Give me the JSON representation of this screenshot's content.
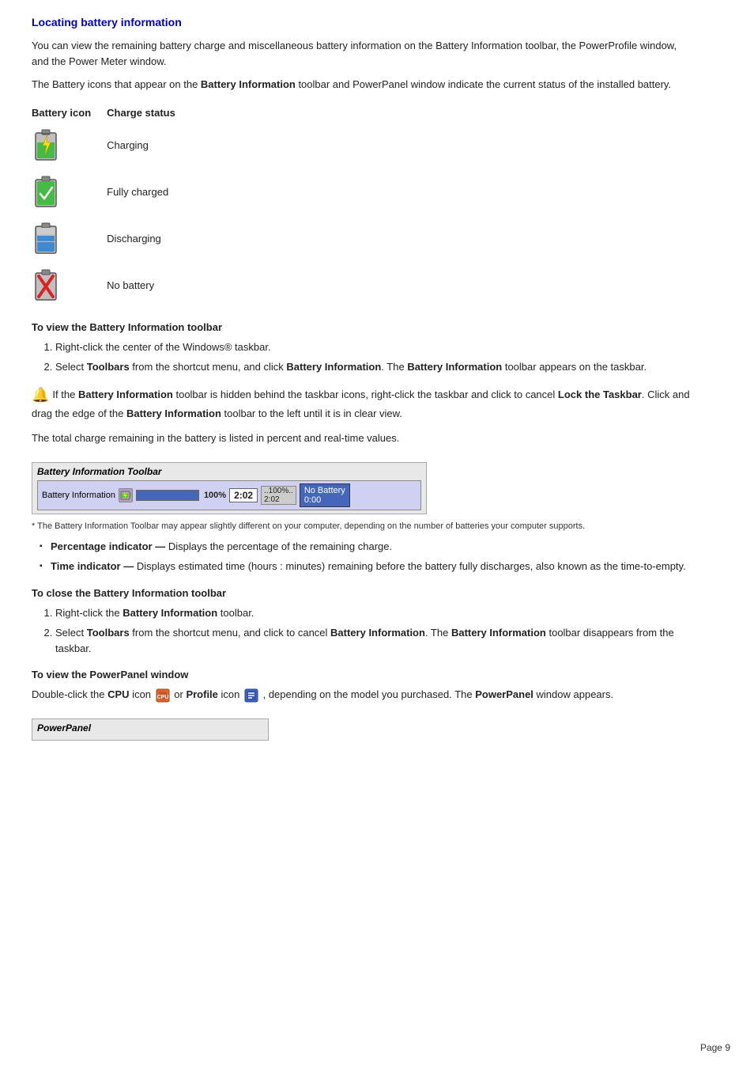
{
  "page": {
    "title": "Locating battery information",
    "page_number": "Page 9",
    "intro_para1": "You can view the remaining battery charge and miscellaneous battery information on the Battery Information toolbar, the PowerProfile window, and the Power Meter window.",
    "intro_para2_prefix": "The Battery icons that appear on the ",
    "intro_para2_bold": "Battery Information",
    "intro_para2_suffix": " toolbar and PowerPanel window indicate the current status of the installed battery.",
    "battery_table": {
      "col1": "Battery icon",
      "col2": "Charge status",
      "rows": [
        {
          "status": "Charging"
        },
        {
          "status": "Fully charged"
        },
        {
          "status": "Discharging"
        },
        {
          "status": "No battery"
        }
      ]
    },
    "section_view_toolbar": {
      "title": "To view the Battery Information toolbar",
      "steps": [
        "Right-click the center of the Windows® taskbar.",
        "Select Toolbars from the shortcut menu, and click Battery Information. The Battery Information toolbar appears on the taskbar."
      ],
      "step2_bolds": [
        "Toolbars",
        "Battery Information",
        "Battery Information"
      ]
    },
    "note_text_prefix": "If the ",
    "note_bold1": "Battery Information",
    "note_text_mid": " toolbar is hidden behind the taskbar icons, right-click the taskbar and click to cancel ",
    "note_bold2": "Lock the Taskbar",
    "note_text_mid2": ". Click and drag the edge of the ",
    "note_bold3": "Battery Information",
    "note_text_suffix": " toolbar to the left until it is in clear view.",
    "total_charge_text": "The total charge remaining in the battery is listed in percent and real-time values.",
    "toolbar_preview": {
      "title": "Battery Information Toolbar",
      "label": "Battery Information",
      "percent": "100%",
      "time": "2:02",
      "pct_display": "..100%..",
      "time_display": "2:02",
      "no_batt": "No Battery",
      "no_batt_time": "0:00"
    },
    "asterisk_note": "* The Battery Information Toolbar may appear slightly different on your computer, depending on the number of batteries your computer supports.",
    "bullet_items": [
      {
        "bold": "Percentage indicator —",
        "text": " Displays the percentage of the remaining charge."
      },
      {
        "bold": "Time indicator —",
        "text": " Displays estimated time (hours : minutes) remaining before the battery fully discharges, also known as the time-to-empty."
      }
    ],
    "section_close_toolbar": {
      "title": "To close the Battery Information toolbar",
      "steps": [
        "Right-click the Battery Information toolbar.",
        "Select Toolbars from the shortcut menu, and click to cancel Battery Information. The Battery Information toolbar disappears from the taskbar."
      ]
    },
    "section_powerpanel": {
      "title": "To view the PowerPanel window",
      "para_prefix": "Double-click the ",
      "para_cpu_bold": "CPU",
      "para_mid": " icon ",
      "para_or": " or ",
      "para_profile_bold": "Profile",
      "para_mid2": " icon ",
      "para_suffix": ", depending on the model you purchased. The ",
      "para_powerpanel_bold": "PowerPanel",
      "para_end": " window appears.",
      "toolbar_title": "PowerPanel"
    }
  }
}
